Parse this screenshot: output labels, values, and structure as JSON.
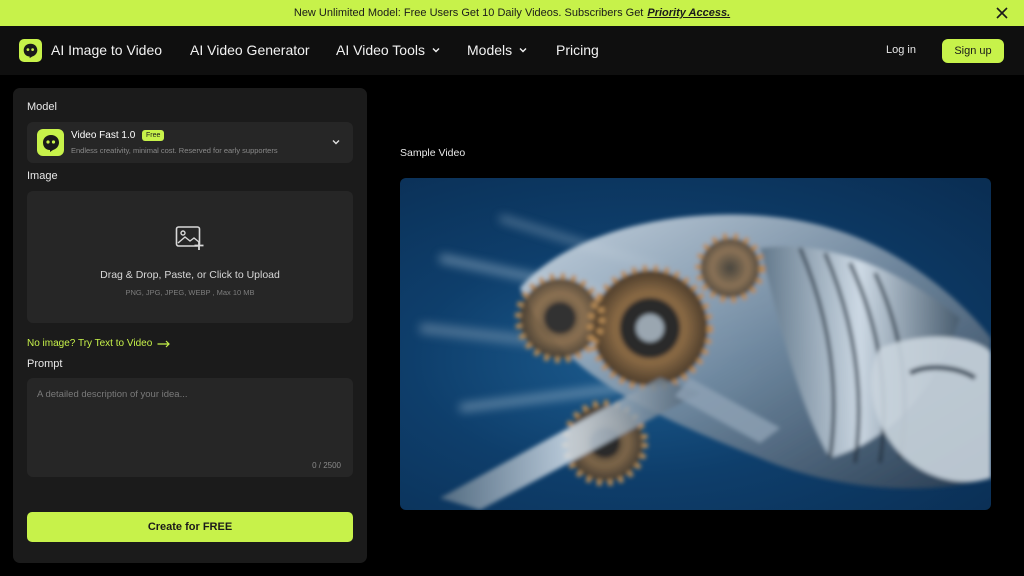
{
  "banner": {
    "text": "New Unlimited Model: Free Users Get 10 Daily Videos. Subscribers Get",
    "highlight": "Priority Access."
  },
  "nav": {
    "items": [
      {
        "label": "AI Image to Video"
      },
      {
        "label": "AI Video Generator"
      },
      {
        "label": "AI Video Tools"
      },
      {
        "label": "Models"
      },
      {
        "label": "Pricing"
      }
    ],
    "login": "Log in",
    "signup": "Sign up"
  },
  "form": {
    "model_label": "Model",
    "model": {
      "name": "Video Fast 1.0",
      "badge": "Free",
      "description": "Endless creativity, minimal cost. Reserved for early supporters"
    },
    "image_label": "Image",
    "upload": {
      "title": "Drag & Drop, Paste, or Click to Upload",
      "subtitle": "PNG, JPG, JPEG, WEBP , Max 10 MB"
    },
    "t2v_link": "No image? Try Text to Video",
    "prompt_label": "Prompt",
    "prompt_placeholder": "A detailed description of your idea...",
    "prompt_counter": "0 / 2500",
    "create_button": "Create for FREE"
  },
  "preview": {
    "label": "Sample Video"
  },
  "colors": {
    "accent": "#c7f24a",
    "background": "#000000",
    "panel": "#1b1b1b",
    "field": "#262626"
  }
}
